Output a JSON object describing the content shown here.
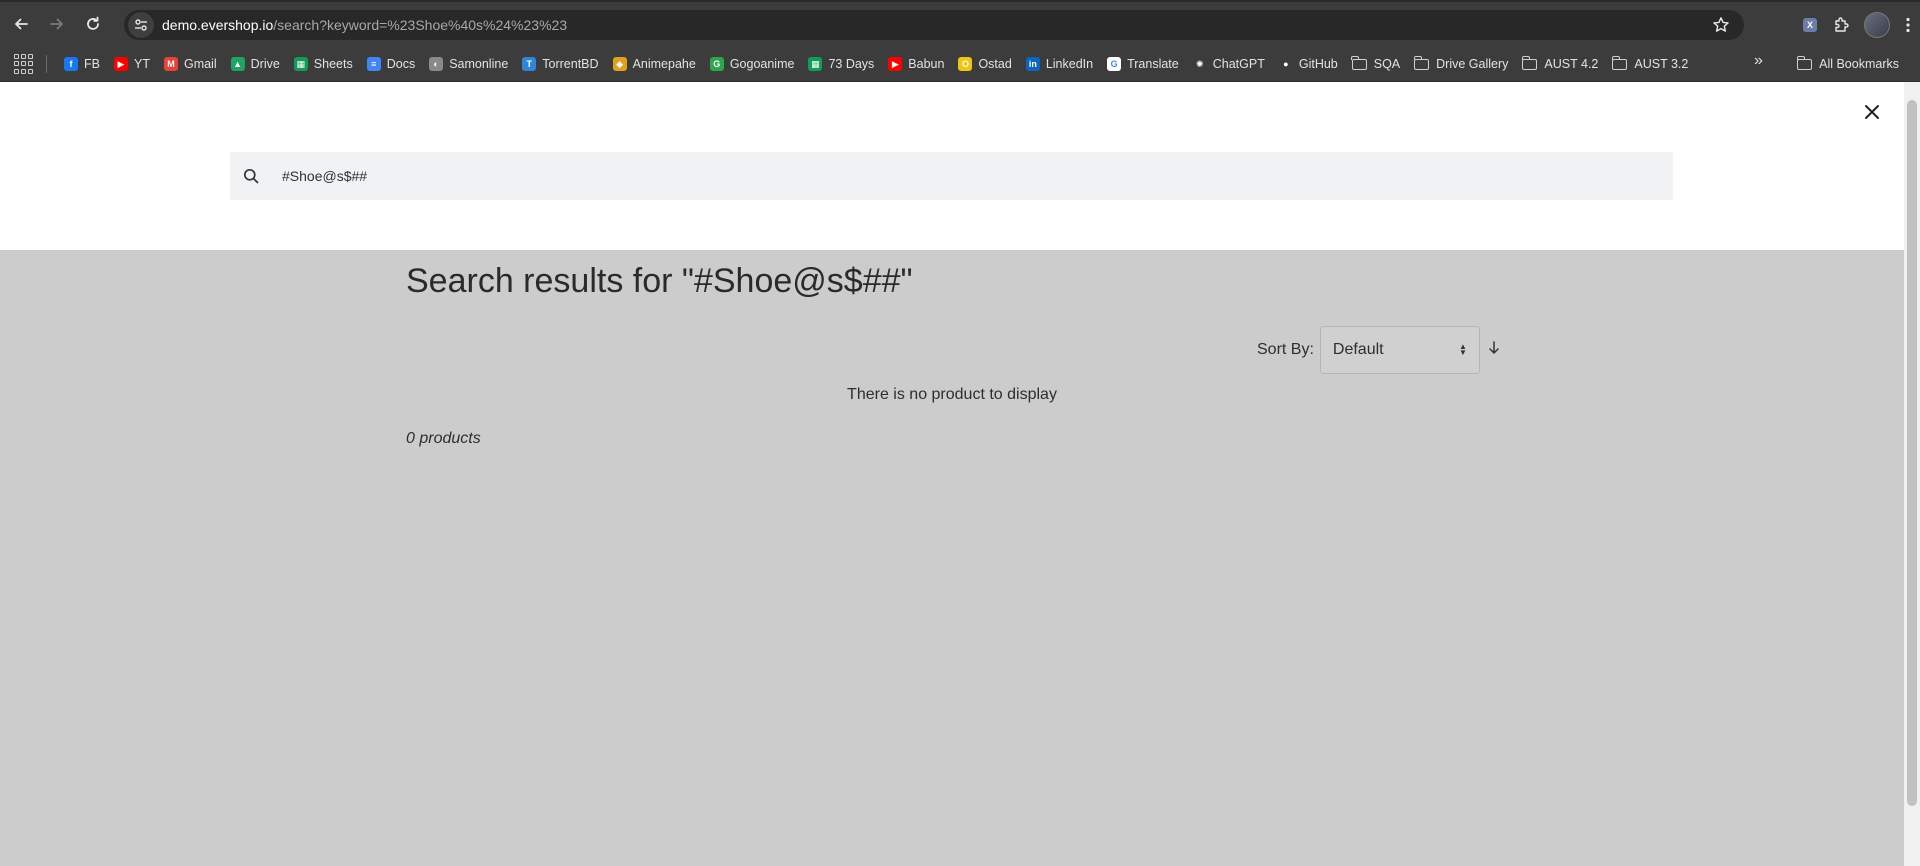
{
  "browser": {
    "url_host": "demo.evershop.io",
    "url_path": "/search?keyword=%23Shoe%40s%24%23%23",
    "bookmarks": [
      {
        "label": "FB",
        "color": "#1877f2",
        "glyph": "f"
      },
      {
        "label": "YT",
        "color": "#ff0000",
        "glyph": "▶"
      },
      {
        "label": "Gmail",
        "color": "#ea4335",
        "glyph": "M"
      },
      {
        "label": "Drive",
        "color": "#1fa463",
        "glyph": "▲"
      },
      {
        "label": "Sheets",
        "color": "#0f9d58",
        "glyph": "▦"
      },
      {
        "label": "Docs",
        "color": "#4285f4",
        "glyph": "≡"
      },
      {
        "label": "Samonline",
        "color": "#8a8a8a",
        "glyph": "◐"
      },
      {
        "label": "TorrentBD",
        "color": "#2f86d6",
        "glyph": "T"
      },
      {
        "label": "Animepahe",
        "color": "#e0a020",
        "glyph": "◆"
      },
      {
        "label": "Gogoanime",
        "color": "#2aa84a",
        "glyph": "G"
      },
      {
        "label": "73 Days",
        "color": "#0f9d58",
        "glyph": "▦"
      },
      {
        "label": "Babun",
        "color": "#ff0000",
        "glyph": "▶"
      },
      {
        "label": "Ostad",
        "color": "#f1c40f",
        "glyph": "O"
      },
      {
        "label": "LinkedIn",
        "color": "#0a66c2",
        "glyph": "in"
      },
      {
        "label": "Translate",
        "color": "#ffffff",
        "glyph": "G"
      },
      {
        "label": "ChatGPT",
        "color": "#3c3c3c",
        "glyph": "✺"
      },
      {
        "label": "GitHub",
        "color": "#3c3c3c",
        "glyph": "●"
      }
    ],
    "folders": [
      "SQA",
      "Drive Gallery",
      "AUST 4.2",
      "AUST 3.2"
    ],
    "all_bookmarks": "All Bookmarks"
  },
  "search": {
    "value": "#Shoe@s$##"
  },
  "results": {
    "title": "Search results for \"#Shoe@s$##\"",
    "sort_label": "Sort By:",
    "sort_value": "Default",
    "empty_message": "There is no product to display",
    "count": "0 products"
  }
}
